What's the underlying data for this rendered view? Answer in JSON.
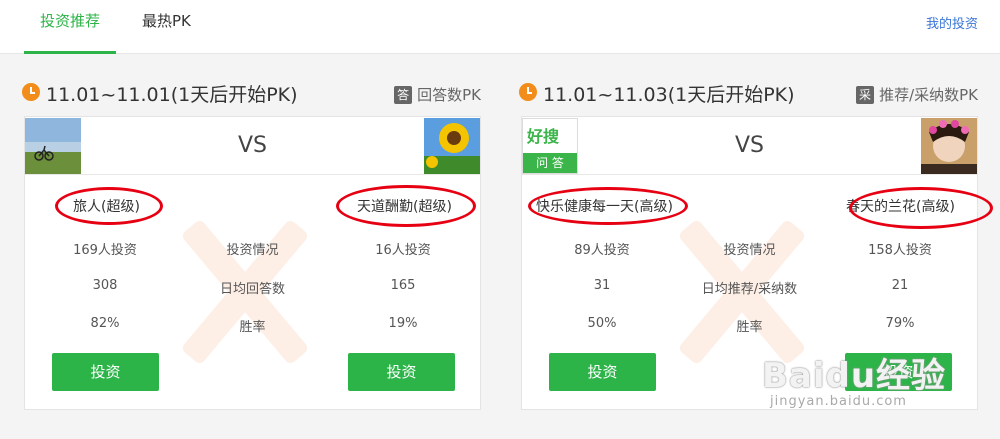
{
  "tabs": [
    {
      "label": "投资推荐",
      "active": true
    },
    {
      "label": "最热PK",
      "active": false
    }
  ],
  "my_invest": "我的投资",
  "panels": [
    {
      "date": "11.01~11.01(1天后开始PK)",
      "pk_badge": "答",
      "pk_type": "回答数PK",
      "vs": "VS",
      "left_name": "旅人(超级)",
      "right_name": "天道酬勤(超级)",
      "rows": [
        {
          "left": "169人投资",
          "label": "投资情况",
          "right": "16人投资"
        },
        {
          "left": "308",
          "label": "日均回答数",
          "right": "165"
        },
        {
          "left": "82%",
          "label": "胜率",
          "right": "19%"
        }
      ],
      "btn_left": "投资",
      "btn_right": "投资"
    },
    {
      "date": "11.01~11.03(1天后开始PK)",
      "pk_badge": "采",
      "pk_type": "推荐/采纳数PK",
      "vs": "VS",
      "left_name": "快乐健康每一天(高级)",
      "right_name": "春天的兰花(高级)",
      "left_avatar_text_top": "好搜",
      "left_avatar_text_bottom": "问 答",
      "rows": [
        {
          "left": "89人投资",
          "label": "投资情况",
          "right": "158人投资"
        },
        {
          "left": "31",
          "label": "日均推荐/采纳数",
          "right": "21"
        },
        {
          "left": "50%",
          "label": "胜率",
          "right": "79%"
        }
      ],
      "btn_left": "投资",
      "btn_right": "投资"
    }
  ],
  "watermark": {
    "text": "Baidu经验",
    "sub": "jingyan.baidu.com"
  },
  "colors": {
    "accent": "#2cb448",
    "link": "#3a76d8",
    "annotation": "#e60012",
    "clock": "#f28c1a"
  }
}
